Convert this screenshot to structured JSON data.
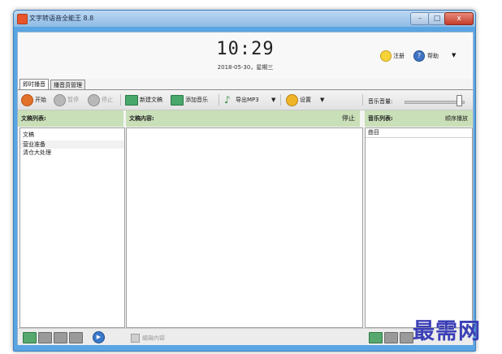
{
  "window": {
    "title": "文字转语音全能王 8.8",
    "controls": {
      "minimize": "–",
      "maximize": "□",
      "close": "x"
    }
  },
  "header": {
    "time": "10:29",
    "date": "2018-05-30，星期三",
    "register_label": "注册",
    "help_label": "帮助",
    "help_arrow": "▼"
  },
  "tabs": [
    {
      "label": "即时播音",
      "active": true
    },
    {
      "label": "播音员管理",
      "active": false
    }
  ],
  "toolbar": {
    "start": "开始",
    "pause": "暂停",
    "stop": "停止",
    "new_doc": "新建文稿",
    "add_music": "添加音乐",
    "export_mp3": "导出MP3",
    "settings": "设置",
    "dropdown_arrow": "▼",
    "music_volume_label": "音乐音量:",
    "music_volume": 0.95
  },
  "doc_list": {
    "header": "文稿列表:",
    "items": [
      "文稿",
      "营业准备",
      "清仓大处理"
    ]
  },
  "doc_content": {
    "header": "文稿内容:",
    "status": "停止",
    "edit_label": "编辑内容"
  },
  "music_list": {
    "header": "音乐列表:",
    "play_mode": "顺序播放",
    "group": "曲目"
  },
  "watermark": "最需网",
  "colors": {
    "frame": "#5aa5e3",
    "panel_header": "#c9dfb8",
    "accent": "#3b3fb6"
  }
}
